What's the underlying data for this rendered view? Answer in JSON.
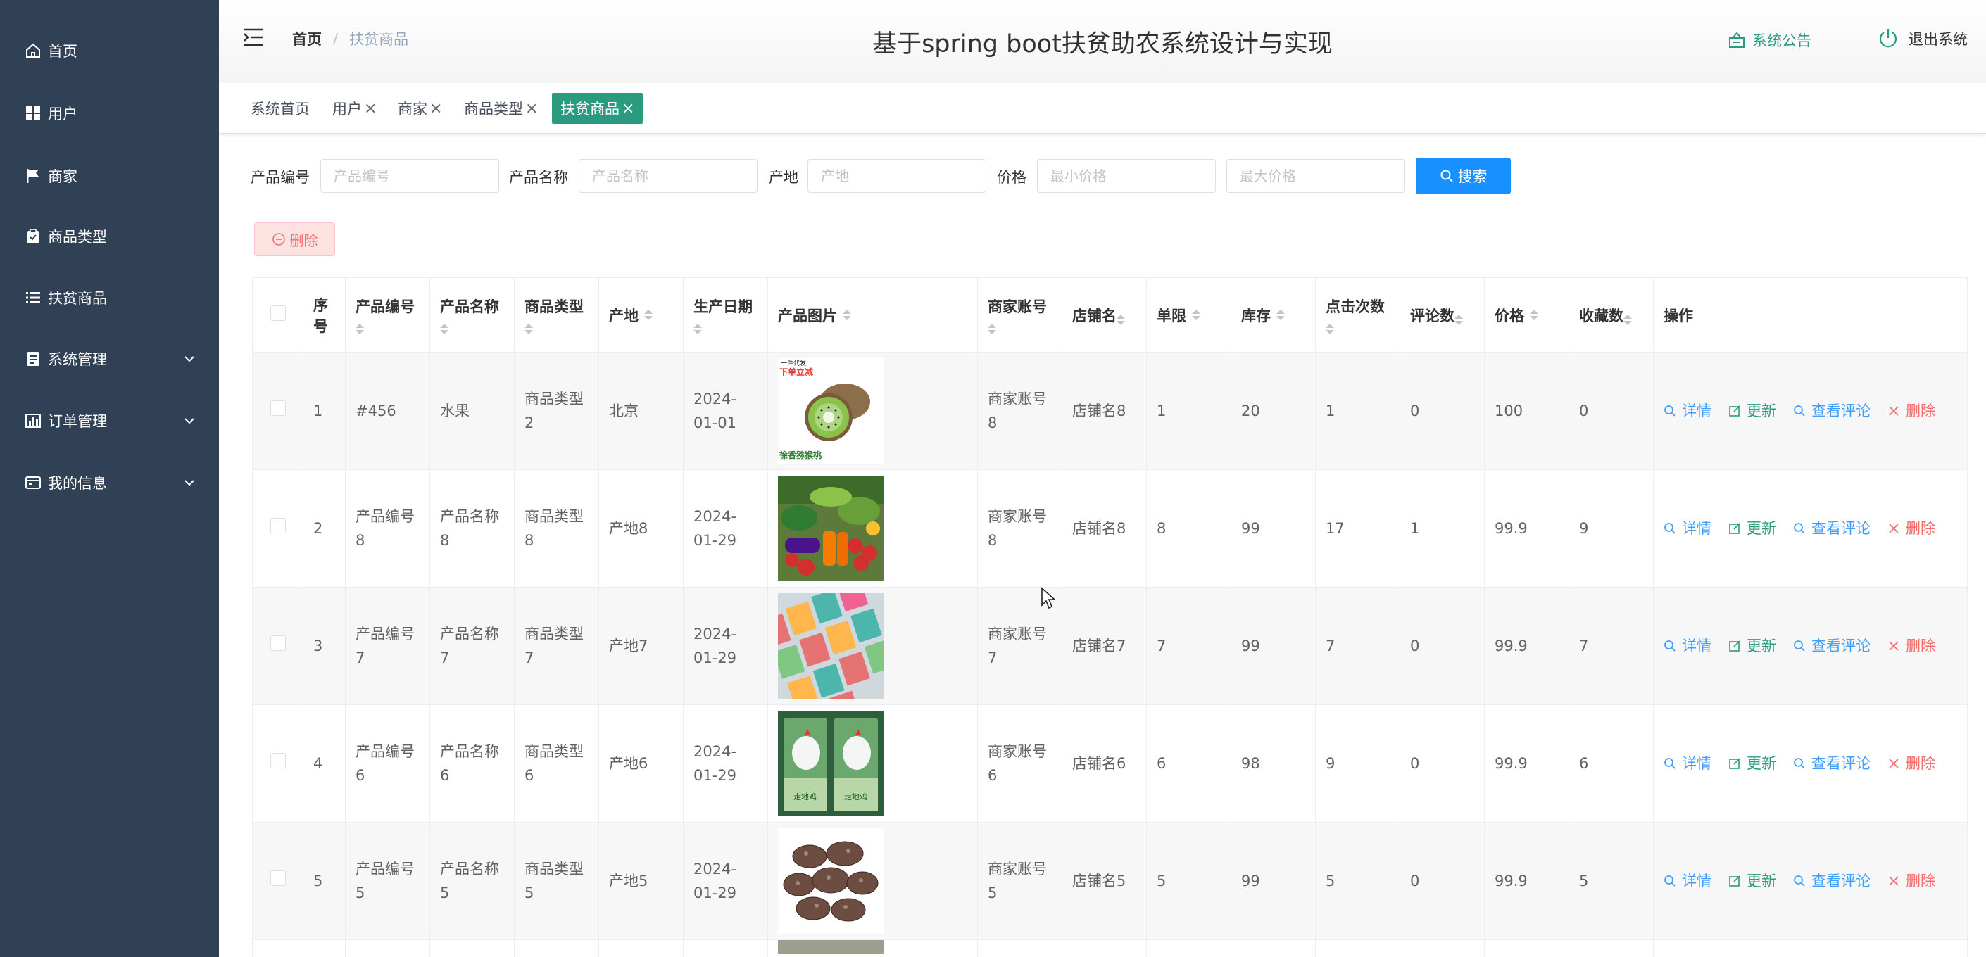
{
  "sidebar": {
    "items": [
      {
        "label": "首页",
        "icon": "home-icon"
      },
      {
        "label": "用户",
        "icon": "grid-icon"
      },
      {
        "label": "商家",
        "icon": "flag-icon"
      },
      {
        "label": "商品类型",
        "icon": "clipboard-icon"
      },
      {
        "label": "扶贫商品",
        "icon": "list-icon"
      },
      {
        "label": "系统管理",
        "icon": "document-icon"
      },
      {
        "label": "订单管理",
        "icon": "chart-icon"
      },
      {
        "label": "我的信息",
        "icon": "card-icon"
      }
    ]
  },
  "header": {
    "breadcrumb": {
      "home": "首页",
      "current": "扶贫商品"
    },
    "title": "基于spring boot扶贫助农系统设计与实现",
    "notice": "系统公告",
    "logout": "退出系统"
  },
  "tabs": [
    {
      "label": "系统首页"
    },
    {
      "label": "用户"
    },
    {
      "label": "商家"
    },
    {
      "label": "商品类型"
    },
    {
      "label": "扶贫商品"
    }
  ],
  "search": {
    "labels": {
      "code": "产品编号",
      "name": "产品名称",
      "origin": "产地",
      "price": "价格"
    },
    "placeholders": {
      "code": "产品编号",
      "name": "产品名称",
      "origin": "产地",
      "min_price": "最小价格",
      "max_price": "最大价格"
    },
    "button": "搜索"
  },
  "actions": {
    "delete": "删除"
  },
  "table": {
    "headers": {
      "index": "序号",
      "code": "产品编号",
      "name": "产品名称",
      "type": "商品类型",
      "origin": "产地",
      "date": "生产日期",
      "image": "产品图片",
      "merchant": "商家账号",
      "shop": "店铺名",
      "limit": "单限",
      "stock": "库存",
      "clicks": "点击次数",
      "comments": "评论数",
      "price": "价格",
      "favorites": "收藏数",
      "ops": "操作"
    },
    "ops": {
      "detail": "详情",
      "update": "更新",
      "comments": "查看评论",
      "delete": "删除"
    },
    "rows": [
      {
        "index": "1",
        "code": "#456",
        "name": "水果",
        "type": "商品类型2",
        "origin": "北京",
        "date": "2024-01-01",
        "image": "kiwi",
        "merchant": "商家账号8",
        "shop": "店铺名8",
        "limit": "1",
        "stock": "20",
        "clicks": "1",
        "comments": "0",
        "price": "100",
        "favorites": "0",
        "image_text_top": "一件代发",
        "image_text_banner": "下单立减",
        "image_text_bottom": "徐香猕猴桃"
      },
      {
        "index": "2",
        "code": "产品编号8",
        "name": "产品名称8",
        "type": "商品类型8",
        "origin": "产地8",
        "date": "2024-01-29",
        "image": "vegetables",
        "merchant": "商家账号8",
        "shop": "店铺名8",
        "limit": "8",
        "stock": "99",
        "clicks": "17",
        "comments": "1",
        "price": "99.9",
        "favorites": "9"
      },
      {
        "index": "3",
        "code": "产品编号7",
        "name": "产品名称7",
        "type": "商品类型7",
        "origin": "产地7",
        "date": "2024-01-29",
        "image": "boxes",
        "merchant": "商家账号7",
        "shop": "店铺名7",
        "limit": "7",
        "stock": "99",
        "clicks": "7",
        "comments": "0",
        "price": "99.9",
        "favorites": "7"
      },
      {
        "index": "4",
        "code": "产品编号6",
        "name": "产品名称6",
        "type": "商品类型6",
        "origin": "产地6",
        "date": "2024-01-29",
        "image": "chicken",
        "merchant": "商家账号6",
        "shop": "店铺名6",
        "limit": "6",
        "stock": "98",
        "clicks": "9",
        "comments": "0",
        "price": "99.9",
        "favorites": "6",
        "image_text_pack": "走地鸡"
      },
      {
        "index": "5",
        "code": "产品编号5",
        "name": "产品名称5",
        "type": "商品类型5",
        "origin": "产地5",
        "date": "2024-01-29",
        "image": "mushroom",
        "merchant": "商家账号5",
        "shop": "店铺名5",
        "limit": "5",
        "stock": "99",
        "clicks": "5",
        "comments": "0",
        "price": "99.9",
        "favorites": "5"
      }
    ]
  },
  "colors": {
    "sidebar": "#304156",
    "accent": "#2a9b7f",
    "primary": "#1890ff",
    "danger": "#f56c6c",
    "link": "#409eff"
  }
}
